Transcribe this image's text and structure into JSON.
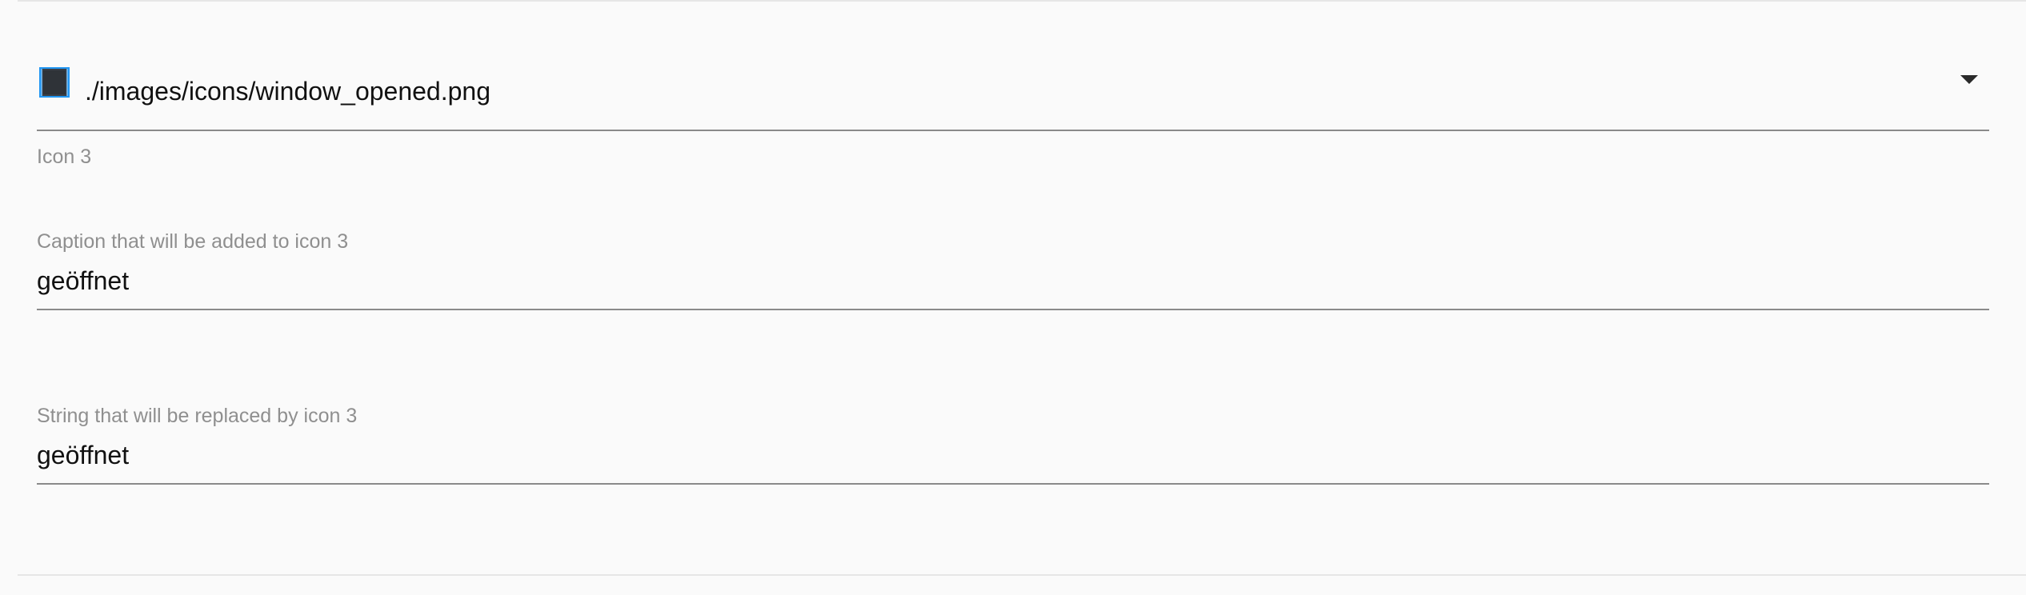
{
  "icon_select": {
    "value": "./images/icons/window_opened.png",
    "icon": "window-opened-icon",
    "helper": "Icon 3"
  },
  "caption_field": {
    "label": "Caption that will be added to icon 3",
    "value": "geöffnet"
  },
  "string_field": {
    "label": "String that will be replaced by icon 3",
    "value": "geöffnet"
  },
  "colors": {
    "background": "#fafafa",
    "label": "#8f8f8f",
    "underline": "#8a8a8a",
    "icon_frame": "#2196f3",
    "icon_body": "#3b3f45"
  }
}
